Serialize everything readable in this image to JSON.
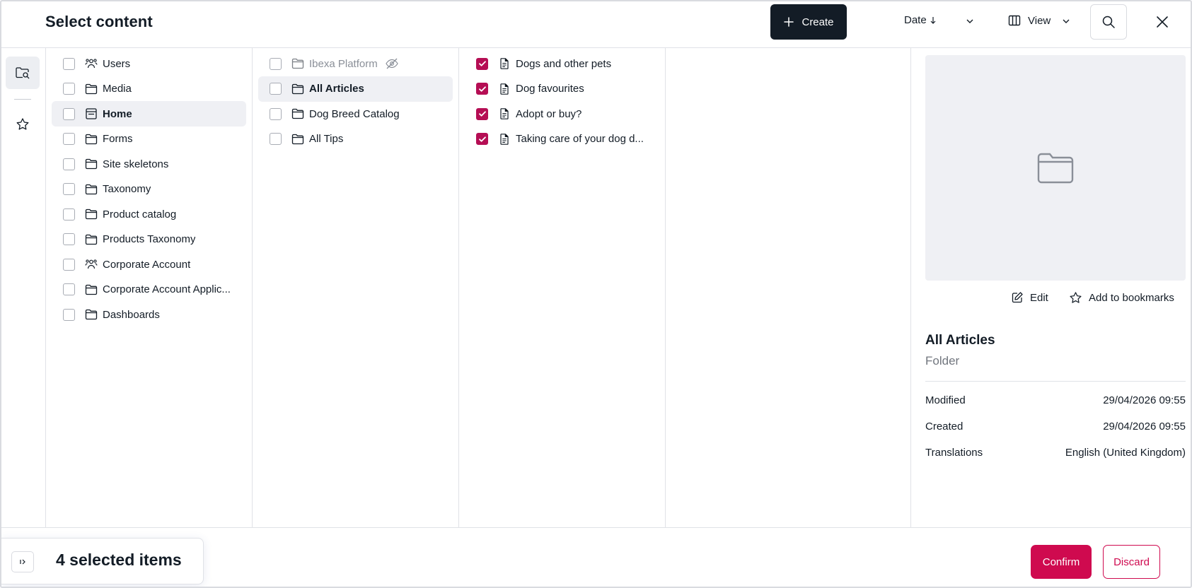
{
  "header": {
    "title": "Select content",
    "create_label": "Create",
    "sort_label": "Date",
    "view_label": "View"
  },
  "column1": [
    {
      "label": "Users",
      "icon": "users-icon",
      "checked": false,
      "active": false
    },
    {
      "label": "Media",
      "icon": "folder-icon",
      "checked": false,
      "active": false
    },
    {
      "label": "Home",
      "icon": "landing-page-icon",
      "checked": false,
      "active": true
    },
    {
      "label": "Forms",
      "icon": "folder-icon",
      "checked": false,
      "active": false
    },
    {
      "label": "Site skeletons",
      "icon": "folder-icon",
      "checked": false,
      "active": false
    },
    {
      "label": "Taxonomy",
      "icon": "folder-icon",
      "checked": false,
      "active": false
    },
    {
      "label": "Product catalog",
      "icon": "folder-icon",
      "checked": false,
      "active": false
    },
    {
      "label": "Products Taxonomy",
      "icon": "folder-icon",
      "checked": false,
      "active": false
    },
    {
      "label": "Corporate Account",
      "icon": "users-icon",
      "checked": false,
      "active": false
    },
    {
      "label": "Corporate Account Applic...",
      "icon": "folder-icon",
      "checked": false,
      "active": false
    },
    {
      "label": "Dashboards",
      "icon": "folder-icon",
      "checked": false,
      "active": false
    }
  ],
  "column2": [
    {
      "label": "Ibexa Platform",
      "icon": "folder-icon",
      "checked": false,
      "active": false,
      "disabled": true
    },
    {
      "label": "All Articles",
      "icon": "folder-icon",
      "checked": false,
      "active": true
    },
    {
      "label": "Dog Breed Catalog",
      "icon": "folder-icon",
      "checked": false,
      "active": false
    },
    {
      "label": "All Tips",
      "icon": "folder-icon",
      "checked": false,
      "active": false
    }
  ],
  "column3": [
    {
      "label": "Dogs and other pets",
      "icon": "article-icon",
      "checked": true
    },
    {
      "label": "Dog favourites",
      "icon": "article-icon",
      "checked": true
    },
    {
      "label": "Adopt or buy?",
      "icon": "article-icon",
      "checked": true
    },
    {
      "label": "Taking care of your dog d...",
      "icon": "article-icon",
      "checked": true
    }
  ],
  "preview": {
    "edit_label": "Edit",
    "bookmark_label": "Add to bookmarks",
    "title": "All Articles",
    "type": "Folder",
    "meta": [
      {
        "key": "Modified",
        "value": "29/04/2026 09:55"
      },
      {
        "key": "Created",
        "value": "29/04/2026 09:55"
      },
      {
        "key": "Translations",
        "value": "English (United Kingdom)"
      }
    ]
  },
  "footer": {
    "selected_label": "4 selected items",
    "confirm_label": "Confirm",
    "discard_label": "Discard"
  },
  "colors": {
    "accent": "#cf0a4f",
    "checkbox_checked": "#b50e54",
    "dark": "#131c26"
  }
}
